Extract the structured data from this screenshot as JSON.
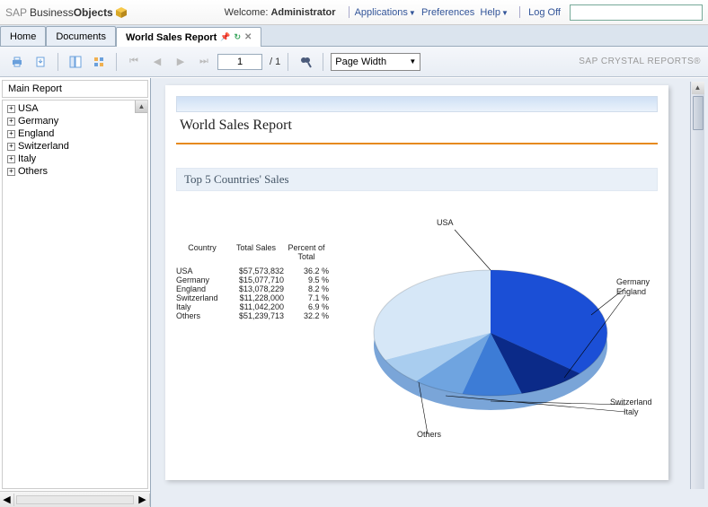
{
  "header": {
    "logo_sap": "SAP",
    "logo_business": "Business",
    "logo_objects": "Objects",
    "welcome_prefix": "Welcome:",
    "welcome_user": "Administrator",
    "links": {
      "applications": "Applications",
      "preferences": "Preferences",
      "help": "Help",
      "logoff": "Log Off"
    },
    "search_placeholder": ""
  },
  "tabs": [
    {
      "label": "Home",
      "active": false
    },
    {
      "label": "Documents",
      "active": false
    },
    {
      "label": "World Sales Report",
      "active": true
    }
  ],
  "toolbar": {
    "page_current": "1",
    "page_total": "/ 1",
    "zoom_selected": "Page Width",
    "watermark": "SAP CRYSTAL REPORTS®"
  },
  "sidebar": {
    "title": "Main Report",
    "tree": [
      "USA",
      "Germany",
      "England",
      "Switzerland",
      "Italy",
      "Others"
    ]
  },
  "report": {
    "title": "World Sales Report",
    "section_title": "Top 5 Countries' Sales",
    "table_headers": {
      "country": "Country",
      "sales": "Total Sales",
      "pct": "Percent of Total"
    },
    "rows": [
      {
        "country": "USA",
        "sales": "$57,573,832",
        "pct": "36.2  %"
      },
      {
        "country": "Germany",
        "sales": "$15,077,710",
        "pct": "9.5  %"
      },
      {
        "country": "England",
        "sales": "$13,078,229",
        "pct": "8.2  %"
      },
      {
        "country": "Switzerland",
        "sales": "$11,228,000",
        "pct": "7.1  %"
      },
      {
        "country": "Italy",
        "sales": "$11,042,200",
        "pct": "6.9  %"
      },
      {
        "country": "Others",
        "sales": "$51,239,713",
        "pct": "32.2  %"
      }
    ]
  },
  "chart_data": {
    "type": "pie",
    "title": "Top 5 Countries' Sales",
    "categories": [
      "USA",
      "Germany",
      "England",
      "Switzerland",
      "Italy",
      "Others"
    ],
    "values": [
      36.2,
      9.5,
      8.2,
      7.1,
      6.9,
      32.2
    ],
    "series_label": "Percent of Total"
  }
}
